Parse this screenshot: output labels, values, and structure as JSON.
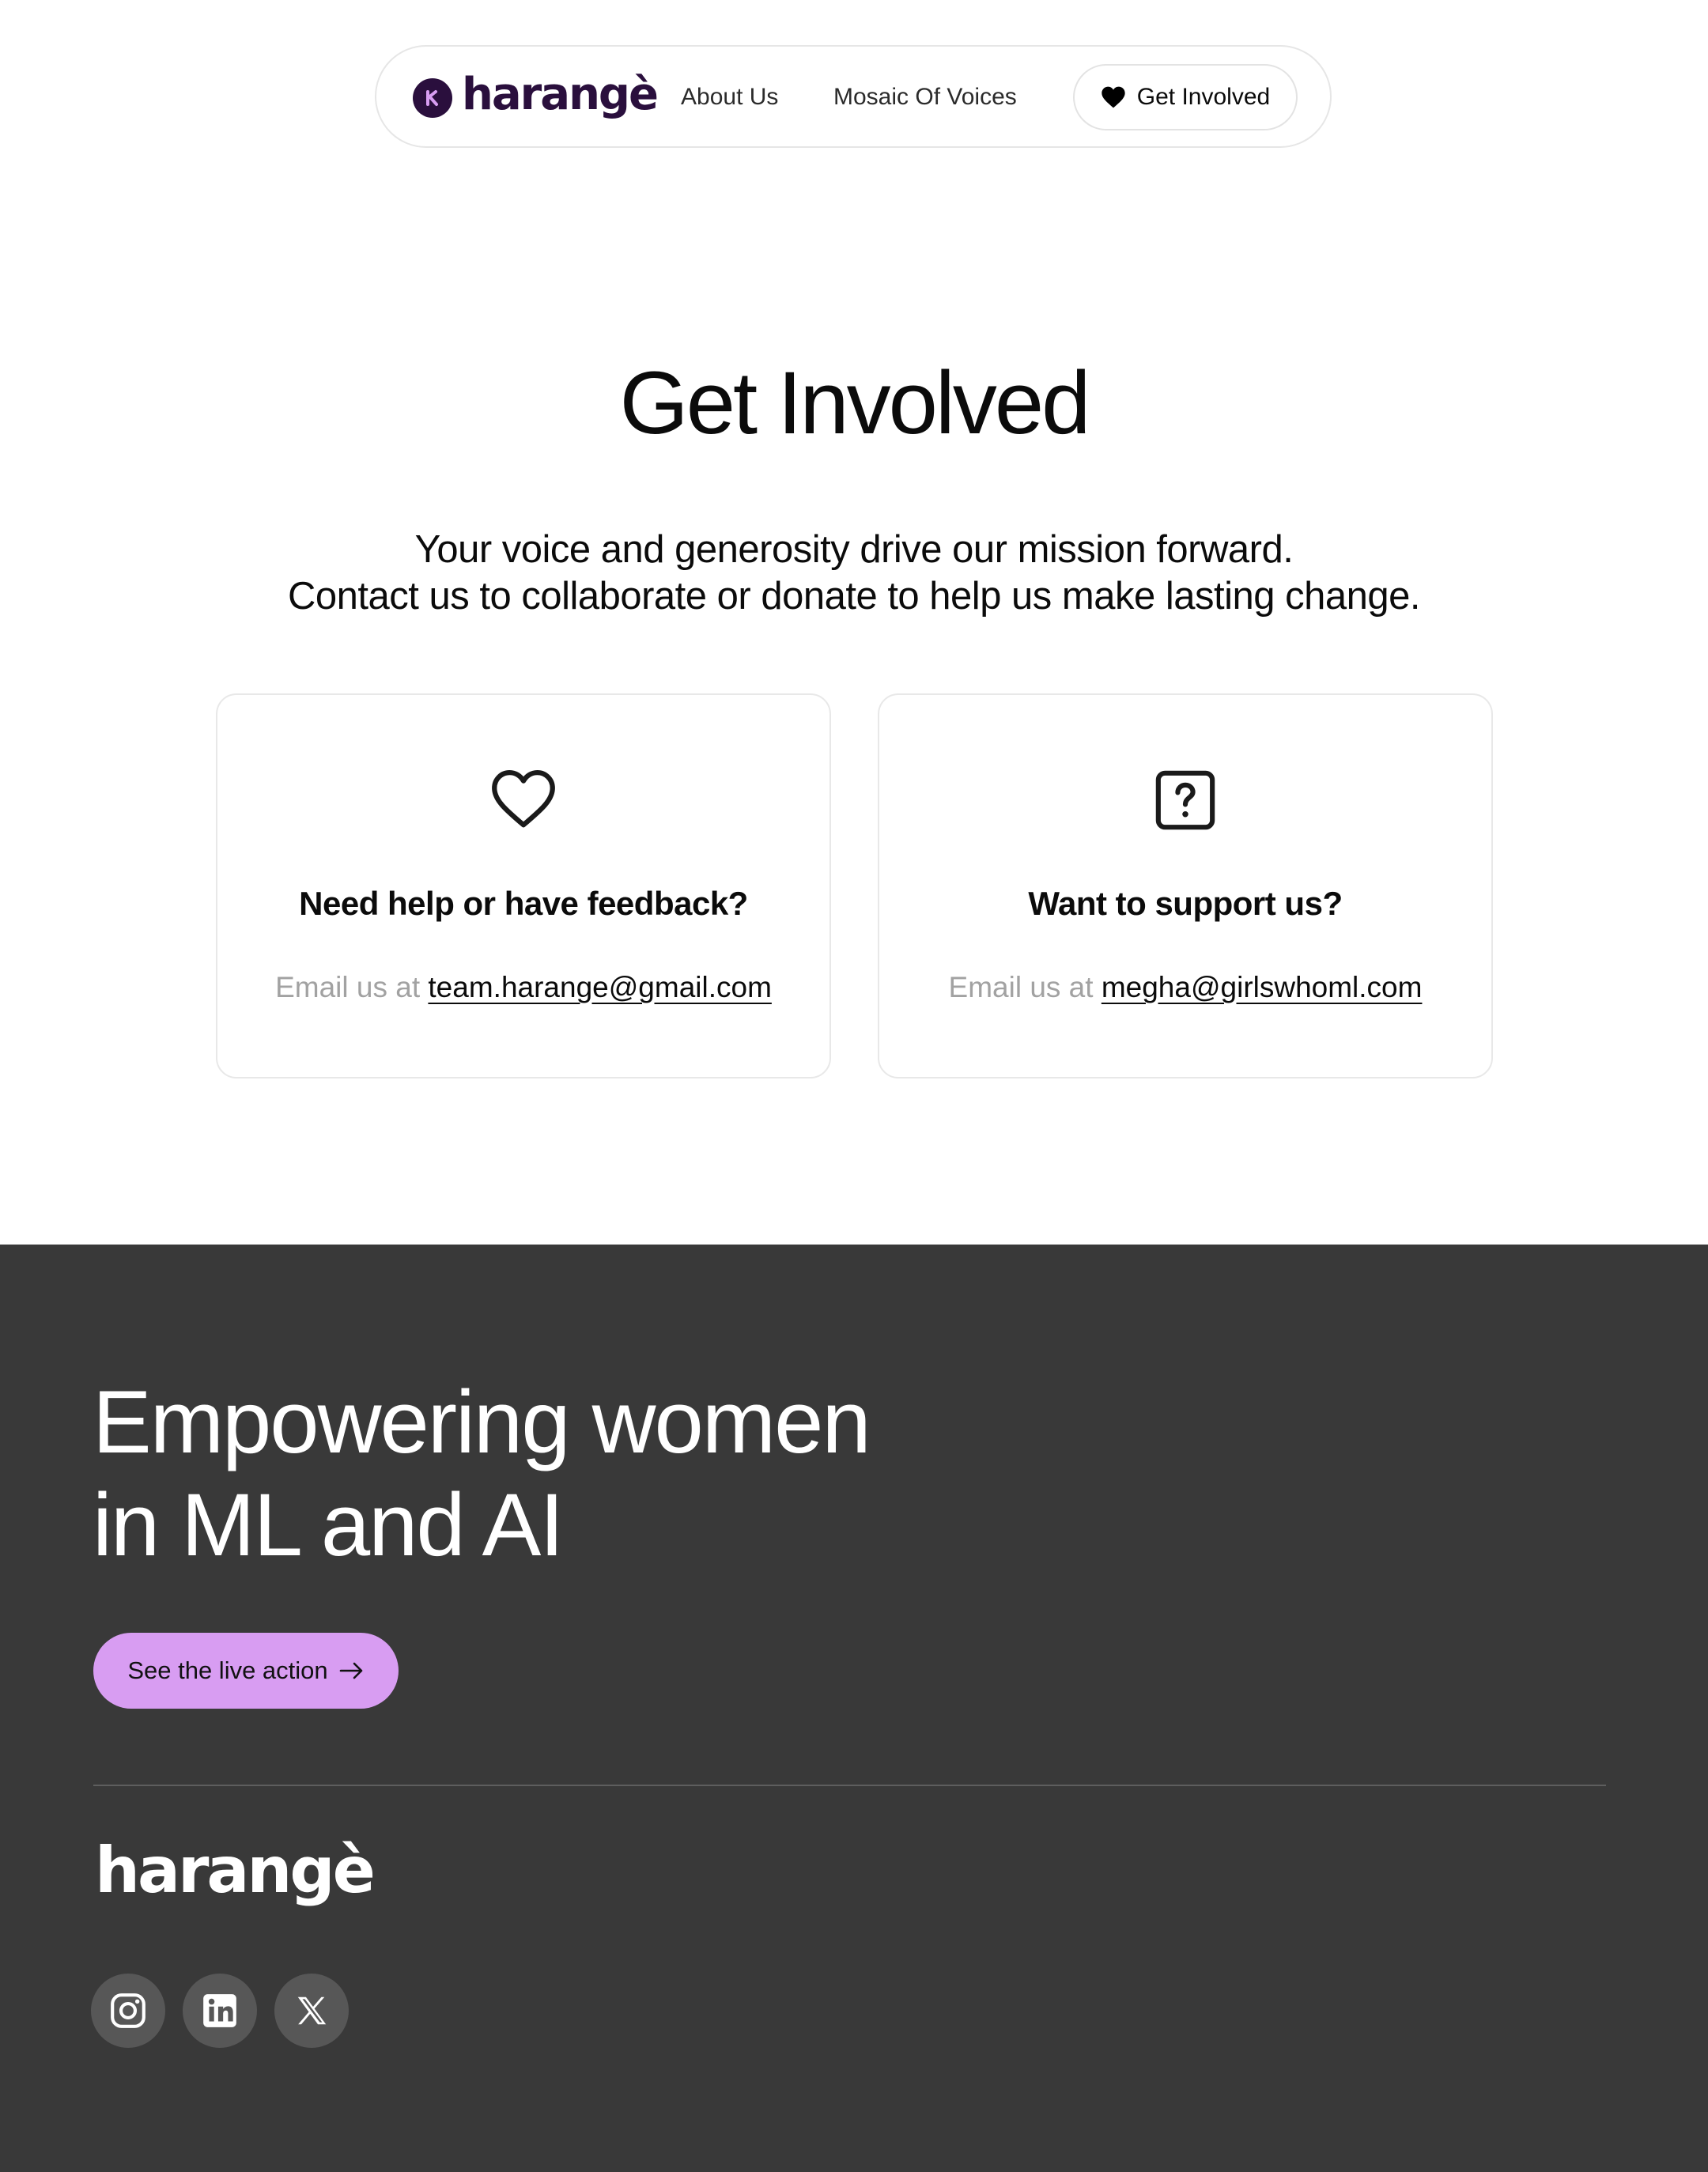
{
  "nav": {
    "brand": "harangè",
    "links": [
      {
        "label": "About Us"
      },
      {
        "label": "Mosaic Of Voices"
      }
    ],
    "cta_label": "Get Involved"
  },
  "hero": {
    "title": "Get Involved",
    "subtitle_line1": "Your voice and generosity drive our mission forward.",
    "subtitle_line2": "Contact us to collaborate or donate to help us make lasting change."
  },
  "cards": [
    {
      "icon": "heart-outline-icon",
      "title": "Need help or have feedback?",
      "prefix": "Email us at",
      "email": "team.harange@gmail.com"
    },
    {
      "icon": "question-square-icon",
      "title": "Want to support us?",
      "prefix": "Email us at",
      "email": "megha@girlswhoml.com"
    }
  ],
  "footer": {
    "heading_line1": "Empowering women",
    "heading_line2": "in ML and AI",
    "button_label": "See the live action",
    "logo": "harangè",
    "socials": [
      "instagram-icon",
      "linkedin-icon",
      "x-icon"
    ]
  },
  "colors": {
    "brand_dark": "#2a0f3d",
    "brand_accent": "#d89df2",
    "footer_bg": "#393939"
  }
}
